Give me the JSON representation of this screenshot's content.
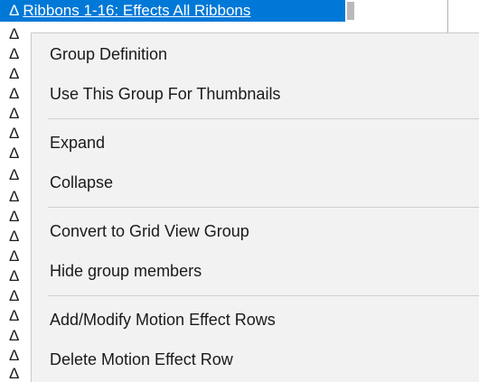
{
  "tree": {
    "selected_label": "Ribbons 1-16: Effects All Ribbons",
    "delta_symbol": "Δ",
    "row_deltas": [
      "Δ",
      "Δ",
      "Δ",
      "Δ",
      "Δ",
      "Δ",
      "Δ",
      "Δ",
      "Δ",
      "Δ",
      "Δ",
      "Δ",
      "Δ",
      "Δ",
      "Δ",
      "Δ",
      "Δ",
      "Δ",
      "Δ"
    ]
  },
  "context_menu": {
    "group_definition": "Group Definition",
    "use_for_thumbnails": "Use This Group For Thumbnails",
    "expand": "Expand",
    "collapse": "Collapse",
    "convert_to_grid": "Convert to Grid View Group",
    "hide_members": "Hide group members",
    "add_modify_motion": "Add/Modify Motion Effect Rows",
    "delete_motion": "Delete Motion Effect Row"
  },
  "colors": {
    "selection": "#0078d7",
    "menu_background": "#f2f2f2"
  }
}
